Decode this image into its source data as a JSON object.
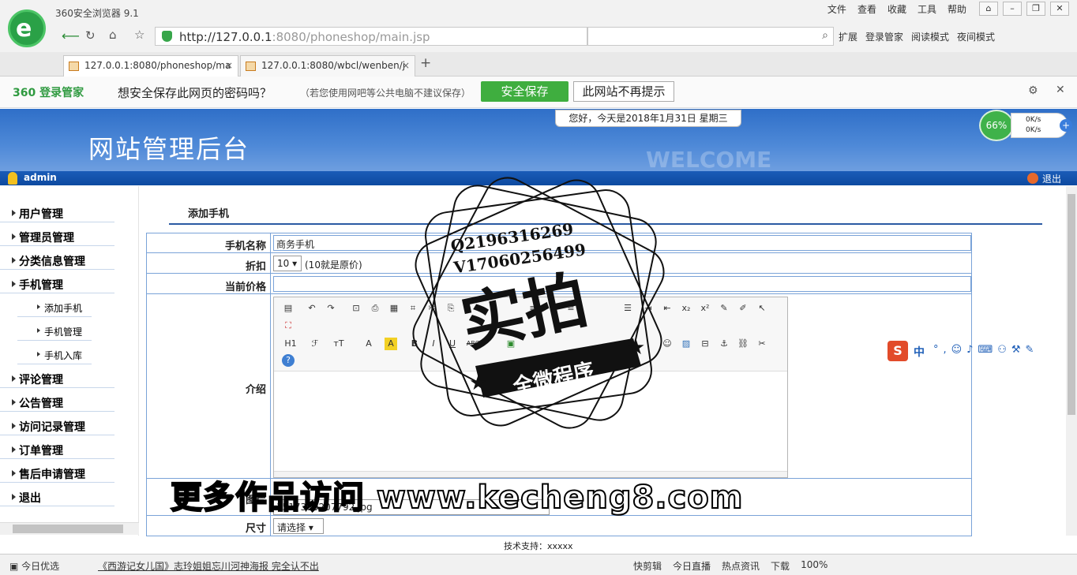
{
  "browser": {
    "app_title": "360安全浏览器 9.1",
    "menu": [
      "文件",
      "查看",
      "收藏",
      "工具",
      "帮助"
    ],
    "url_host": "http://127.0.0.1",
    "url_rest": ":8080/phoneshop/main.jsp",
    "toolbar": [
      "扩展",
      "登录管家",
      "阅读模式",
      "夜间模式"
    ],
    "tabs": [
      {
        "label": "127.0.0.1:8080/phoneshop/ma",
        "active": true
      },
      {
        "label": "127.0.0.1:8080/wbcl/wenben/j",
        "active": false
      }
    ],
    "new_tab": "+"
  },
  "password_bar": {
    "brand": "360 登录管家",
    "question": "想安全保存此网页的密码吗？",
    "note": "（若您使用网吧等公共电脑不建议保存）",
    "save_label": "安全保存",
    "never_label": "此网站不再提示"
  },
  "speed_widget": {
    "percent": "66%",
    "up": "0K/s",
    "down": "0K/s"
  },
  "banner": {
    "title": "网站管理后台",
    "welcome": "WELCOME",
    "date_text": "您好，今天是2018年1月31日 星期三"
  },
  "userbar": {
    "username": "admin",
    "logout": "退出"
  },
  "sidebar": {
    "items": [
      "用户管理",
      "管理员管理",
      "分类信息管理",
      "手机管理"
    ],
    "sub_items": [
      "添加手机",
      "手机管理",
      "手机入库"
    ],
    "items_after": [
      "评论管理",
      "公告管理",
      "访问记录管理",
      "订单管理",
      "售后申请管理",
      "退出"
    ]
  },
  "main": {
    "title": "添加手机",
    "form": {
      "name_label": "手机名称",
      "name_value": "商务手机",
      "discount_label": "折扣",
      "discount_value": "10",
      "discount_hint": "(10就是原价)",
      "price_label": "当前价格",
      "price_value": "",
      "intro_label": "介绍",
      "image_label": "图片",
      "image_value": "1517380207792.jpg",
      "size_label": "尺寸",
      "size_value": "请选择"
    }
  },
  "editor_toolbar": {
    "heading": "H1",
    "font": "ℱ",
    "size": "тT",
    "bold": "B",
    "italic": "I",
    "underline": "U",
    "strike": "ABC",
    "sub": "x₂",
    "sup": "x²",
    "help": "?"
  },
  "footer": {
    "support": "技术支持：xxxxx"
  },
  "statusbar": {
    "left": "今日优选",
    "news": "《西游记女儿国》志玲姐姐忘川河神海报 完全认不出",
    "right": [
      "快剪辑",
      "今日直播",
      "热点资讯",
      "下载",
      "100%"
    ]
  },
  "ime": {
    "s": "S",
    "zh": "中"
  },
  "watermark": {
    "q": "Q2196316269",
    "v": "V17060256499",
    "big": "实拍",
    "ribbon": "全微程序",
    "bottom": "更多作品访问 www.kecheng8.com"
  }
}
